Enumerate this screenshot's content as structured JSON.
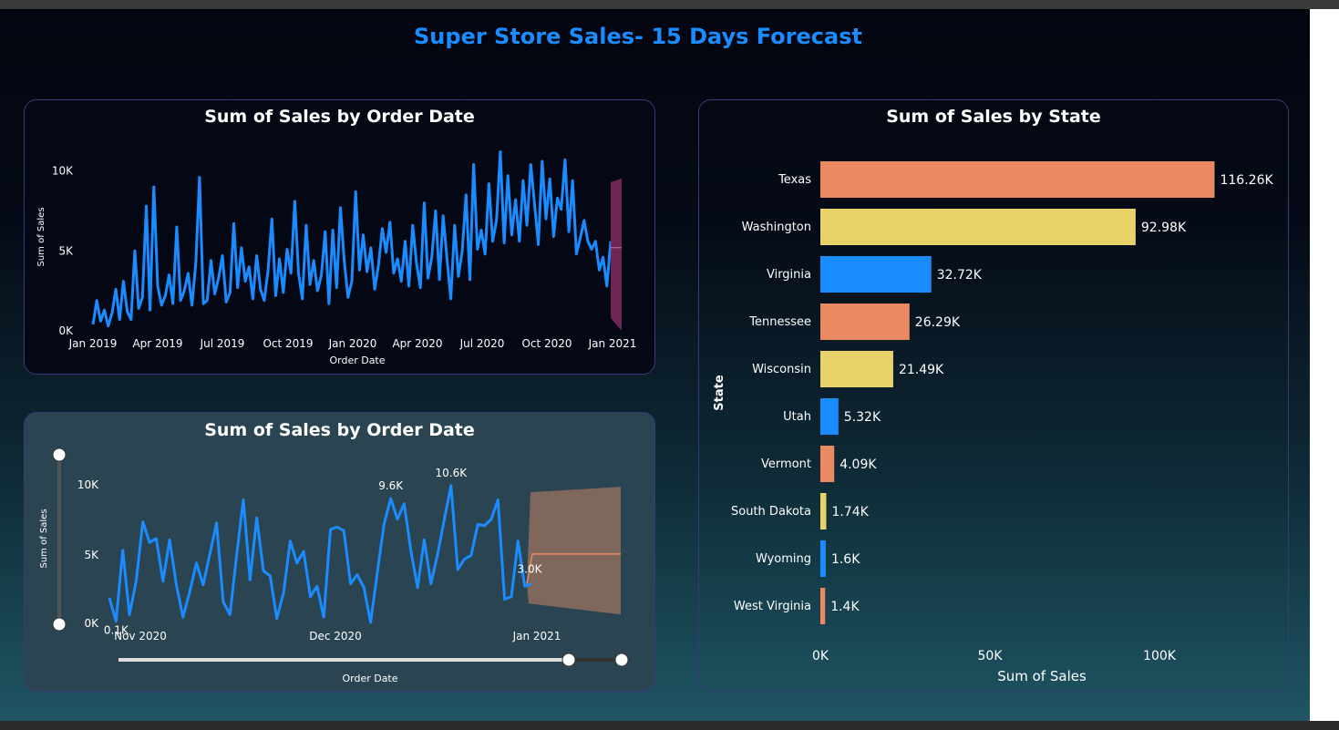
{
  "page": {
    "title": "Super Store Sales- 15 Days Forecast"
  },
  "colors": {
    "blue": "#1a8cff",
    "orange": "#e98a63",
    "yellow": "#e8d26a",
    "forecast_band": "#7a2a5c",
    "forecast_band2": "#8a6a5c"
  },
  "chart_data": [
    {
      "type": "line",
      "title": "Sum of Sales by Order Date",
      "xlabel": "Order Date",
      "ylabel": "Sum of Sales",
      "x_tick_labels": [
        "Jan 2019",
        "Apr 2019",
        "Jul 2019",
        "Oct 2019",
        "Jan 2020",
        "Apr 2020",
        "Jul 2020",
        "Oct 2020",
        "Jan 2021"
      ],
      "y_tick_labels": [
        "0K",
        "5K",
        "10K"
      ],
      "ylim": [
        0,
        11000
      ],
      "series": [
        {
          "values": [
            400,
            1900,
            600,
            1300,
            300,
            1100,
            2600,
            700,
            3100,
            1200,
            700,
            5000,
            1400,
            2100,
            7800,
            1300,
            9000,
            2800,
            1600,
            2200,
            3500,
            1700,
            6500,
            1900,
            2500,
            3600,
            1600,
            4200,
            9600,
            1700,
            1900,
            4400,
            2300,
            3300,
            4700,
            1800,
            2400,
            6700,
            2700,
            5200,
            3100,
            4000,
            2000,
            4700,
            2600,
            1900,
            3800,
            7000,
            2200,
            4500,
            2400,
            5100,
            3600,
            8100,
            3600,
            2000,
            6600,
            2900,
            4400,
            2500,
            3500,
            6200,
            1700,
            6300,
            2700,
            7700,
            4400,
            2100,
            3100,
            8700,
            3800,
            6000,
            3700,
            5200,
            2600,
            4100,
            6400,
            4900,
            6800,
            3600,
            4500,
            3100,
            5600,
            2800,
            6600,
            4200,
            2700,
            8000,
            3300,
            4600,
            7500,
            3200,
            7200,
            4500,
            2000,
            6600,
            3400,
            5000,
            8500,
            3200,
            10400,
            5100,
            6300,
            4800,
            9200,
            5600,
            6900,
            11200,
            5500,
            9700,
            6000,
            8200,
            5600,
            9400,
            6600,
            10400,
            7900,
            5400,
            10600,
            7000,
            9500,
            5900,
            8300,
            7600,
            10700,
            6200,
            9400,
            4800,
            5800,
            6900,
            5600,
            5100,
            5600,
            3800,
            4600,
            2800,
            5600
          ],
          "start_label": "Jan 2019",
          "end_label": "Jan 2021"
        }
      ],
      "forecast": {
        "lower": 800,
        "upper": 9300
      }
    },
    {
      "type": "line",
      "title": "Sum of Sales by Order Date",
      "xlabel": "Order Date",
      "ylabel": "Sum of Sales",
      "x_tick_labels": [
        "Nov 2020",
        "Dec 2020",
        "Jan 2021"
      ],
      "y_tick_labels": [
        "0K",
        "5K",
        "10K"
      ],
      "ylim": [
        0,
        12000
      ],
      "series": [
        {
          "values": [
            1900,
            100,
            5600,
            600,
            3200,
            7800,
            6200,
            6500,
            3200,
            6400,
            2900,
            400,
            2400,
            4600,
            2900,
            5300,
            7700,
            1600,
            600,
            5200,
            9500,
            3300,
            8100,
            4000,
            3600,
            300,
            2300,
            6300,
            4600,
            5500,
            2000,
            2800,
            400,
            7200,
            7400,
            7100,
            3000,
            3700,
            2700,
            0,
            3900,
            7600,
            9600,
            8000,
            9200,
            5600,
            2700,
            6400,
            3000,
            5300,
            8000,
            10600,
            4100,
            4900,
            5200,
            7600,
            7500,
            8000,
            9500,
            1800,
            2000,
            6300,
            2800,
            3000
          ]
        }
      ],
      "data_labels": [
        {
          "index": 1,
          "text": "0.1K"
        },
        {
          "index": 42,
          "text": "9.6K"
        },
        {
          "index": 51,
          "text": "10.6K"
        },
        {
          "index": 63,
          "text": "3.0K"
        }
      ],
      "forecast": {
        "value": 5300,
        "lower": 900,
        "upper": 9800
      }
    },
    {
      "type": "bar",
      "orientation": "horizontal",
      "title": "Sum of Sales by State",
      "xlabel": "Sum of Sales",
      "ylabel": "State",
      "categories": [
        "Texas",
        "Washington",
        "Virginia",
        "Tennessee",
        "Wisconsin",
        "Utah",
        "Vermont",
        "South Dakota",
        "Wyoming",
        "West Virginia"
      ],
      "values": [
        116260,
        92980,
        32720,
        26290,
        21490,
        5320,
        4090,
        1740,
        1600,
        1400
      ],
      "data_labels": [
        "116.26K",
        "92.98K",
        "32.72K",
        "26.29K",
        "21.49K",
        "5.32K",
        "4.09K",
        "1.74K",
        "1.6K",
        "1.4K"
      ],
      "bar_colors": [
        "#e98a63",
        "#e8d26a",
        "#1a8cff",
        "#e98a63",
        "#e8d26a",
        "#1a8cff",
        "#e98a63",
        "#e8d26a",
        "#1a8cff",
        "#e98a63"
      ],
      "x_tick_labels": [
        "0K",
        "50K",
        "100K"
      ],
      "xlim": [
        0,
        125000
      ]
    }
  ]
}
